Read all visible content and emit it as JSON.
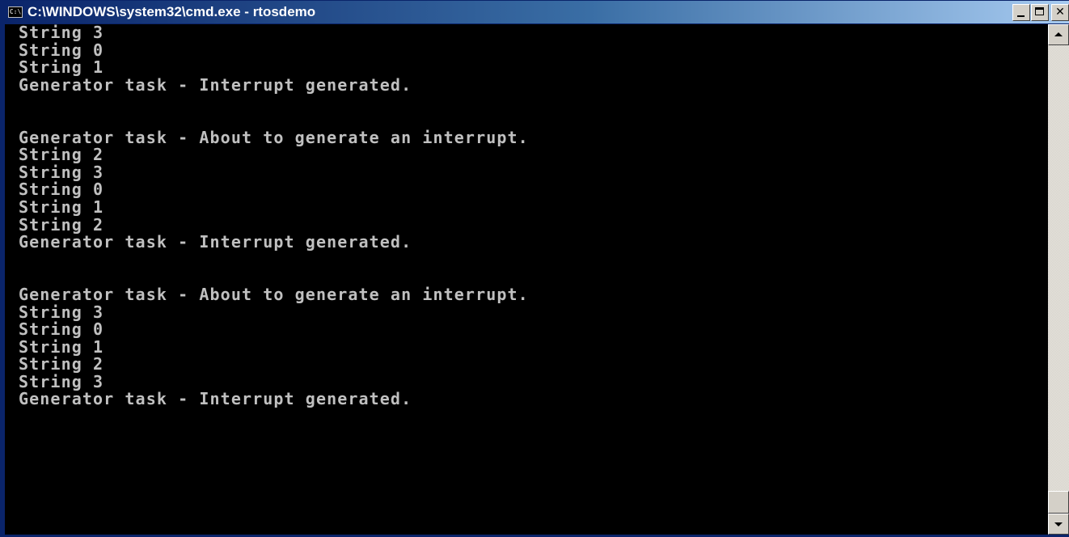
{
  "window": {
    "title": "C:\\WINDOWS\\system32\\cmd.exe - rtosdemo",
    "icon_name": "cmd-icon",
    "icon_glyph": "C:\\",
    "caption_buttons": {
      "minimize": "minimize-icon",
      "maximize": "maximize-icon",
      "close": "close-icon"
    }
  },
  "console": {
    "foreground": "#c0c0c0",
    "background": "#000000",
    "lines": [
      "String 3",
      "String 0",
      "String 1",
      "Generator task - Interrupt generated.",
      "",
      "",
      "Generator task - About to generate an interrupt.",
      "String 2",
      "String 3",
      "String 0",
      "String 1",
      "String 2",
      "Generator task - Interrupt generated.",
      "",
      "",
      "Generator task - About to generate an interrupt.",
      "String 3",
      "String 0",
      "String 1",
      "String 2",
      "String 3",
      "Generator task - Interrupt generated.",
      "",
      ""
    ]
  },
  "scrollbar": {
    "up_icon": "scroll-up-arrow-icon",
    "down_icon": "scroll-down-arrow-icon",
    "position": 1.0
  },
  "colors": {
    "titlebar_start": "#0a246a",
    "titlebar_end": "#a6caf0",
    "chrome": "#d4d0c8"
  }
}
